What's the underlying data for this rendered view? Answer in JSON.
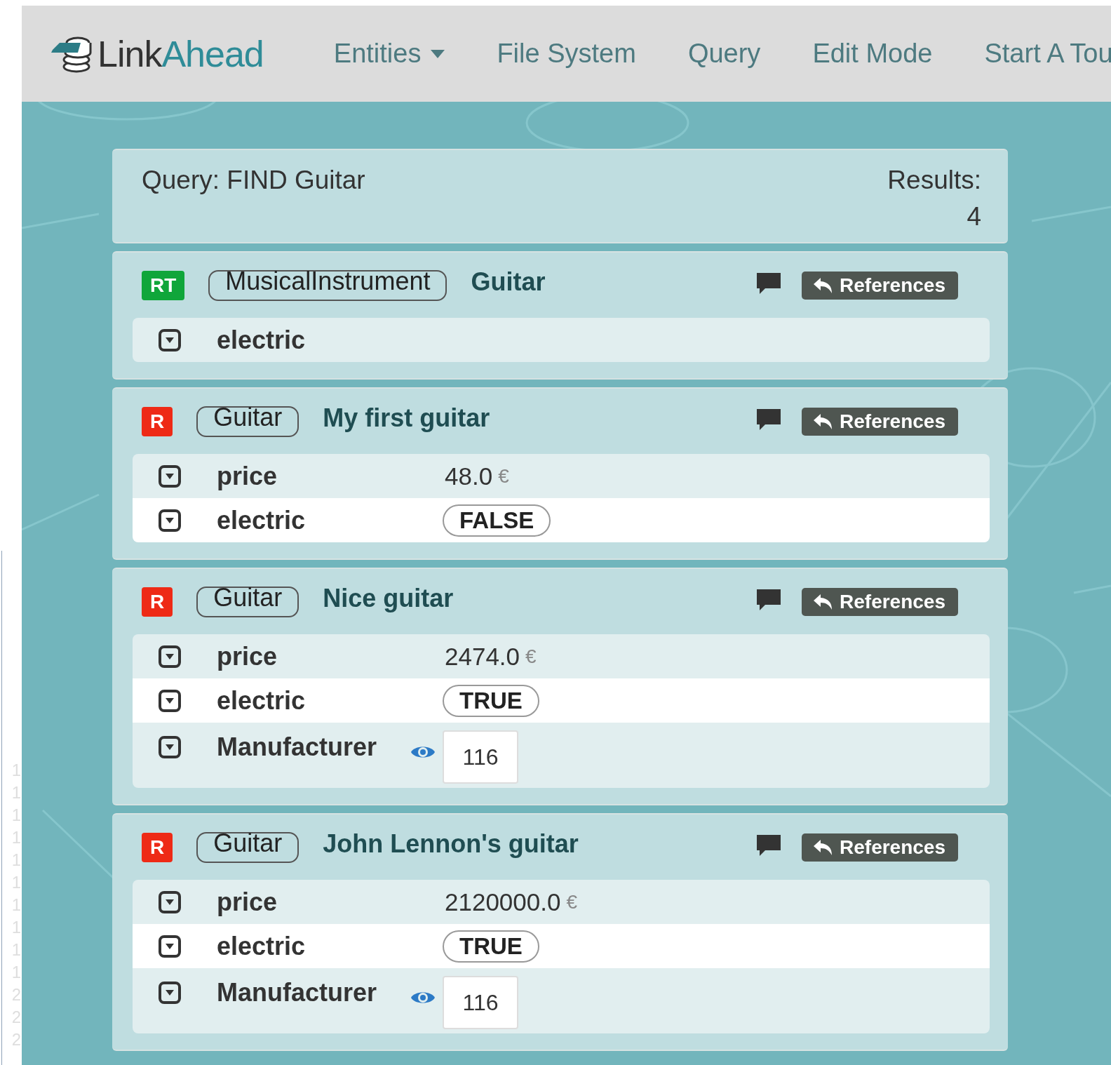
{
  "gutter": [
    "1",
    "1",
    "1",
    "1",
    "1",
    "1",
    "1",
    "1",
    "1",
    "1",
    "2",
    "2",
    "2"
  ],
  "navbar": {
    "brand": {
      "first": "Link",
      "second": "Ahead"
    },
    "items": [
      {
        "label": "Entities",
        "dropdown": true
      },
      {
        "label": "File System",
        "dropdown": false
      },
      {
        "label": "Query",
        "dropdown": false
      },
      {
        "label": "Edit Mode",
        "dropdown": false
      },
      {
        "label": "Start A Tou",
        "dropdown": false
      }
    ]
  },
  "query": {
    "text": "Query: FIND Guitar",
    "results_label": "Results:",
    "results_count": "4"
  },
  "entities": [
    {
      "role": "RT",
      "parent": "MusicalInstrument",
      "name": "Guitar",
      "references": "References",
      "properties": [
        {
          "kind": "plain",
          "name": "electric"
        }
      ]
    },
    {
      "role": "R",
      "parent": "Guitar",
      "name": "My first guitar",
      "references": "References",
      "properties": [
        {
          "kind": "number",
          "name": "price",
          "value": "48.0",
          "unit": "€"
        },
        {
          "kind": "boolean",
          "name": "electric",
          "value": "FALSE"
        }
      ]
    },
    {
      "role": "R",
      "parent": "Guitar",
      "name": "Nice guitar",
      "references": "References",
      "properties": [
        {
          "kind": "number",
          "name": "price",
          "value": "2474.0",
          "unit": "€"
        },
        {
          "kind": "boolean",
          "name": "electric",
          "value": "TRUE"
        },
        {
          "kind": "reference",
          "name": "Manufacturer",
          "value": "116"
        }
      ]
    },
    {
      "role": "R",
      "parent": "Guitar",
      "name": "John Lennon's guitar",
      "references": "References",
      "properties": [
        {
          "kind": "number",
          "name": "price",
          "value": "2120000.0",
          "unit": "€"
        },
        {
          "kind": "boolean",
          "name": "electric",
          "value": "TRUE"
        },
        {
          "kind": "reference",
          "name": "Manufacturer",
          "value": "116"
        }
      ]
    }
  ]
}
